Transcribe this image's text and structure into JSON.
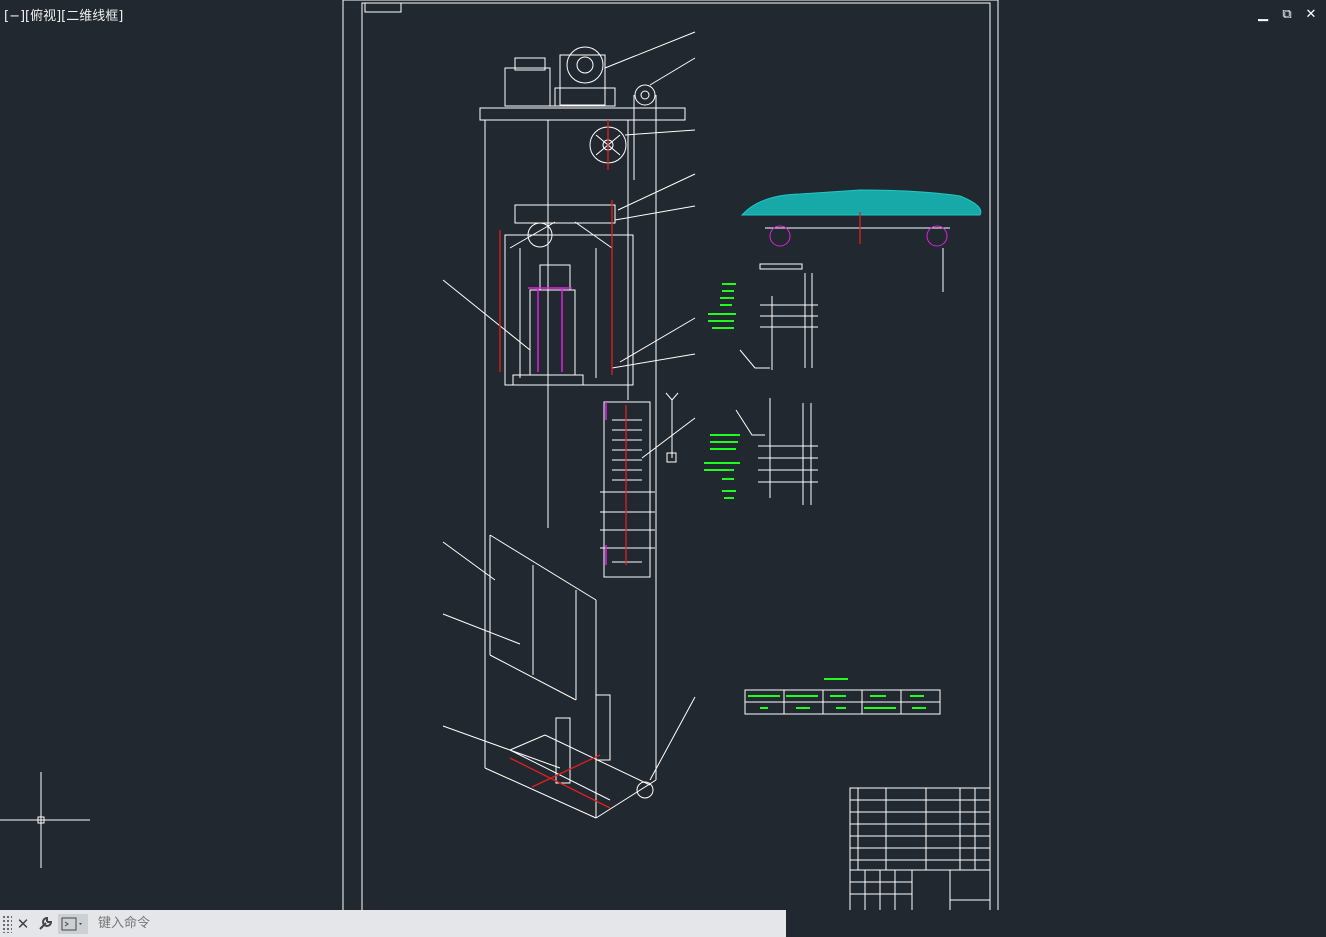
{
  "viewport": {
    "label": "[−][俯视][二维线框]"
  },
  "window_controls": {
    "minimize": "▁",
    "restore": "⧉",
    "close": "✕"
  },
  "command_line": {
    "placeholder": "键入命令",
    "close_glyph": "✕",
    "wrench_glyph": "🔧"
  },
  "colors": {
    "background": "#212830",
    "line": "#ffffff",
    "accent_red": "#e02020",
    "accent_magenta": "#e020e0",
    "accent_cyan": "#20c8c8",
    "annotation_green": "#20ff20"
  }
}
